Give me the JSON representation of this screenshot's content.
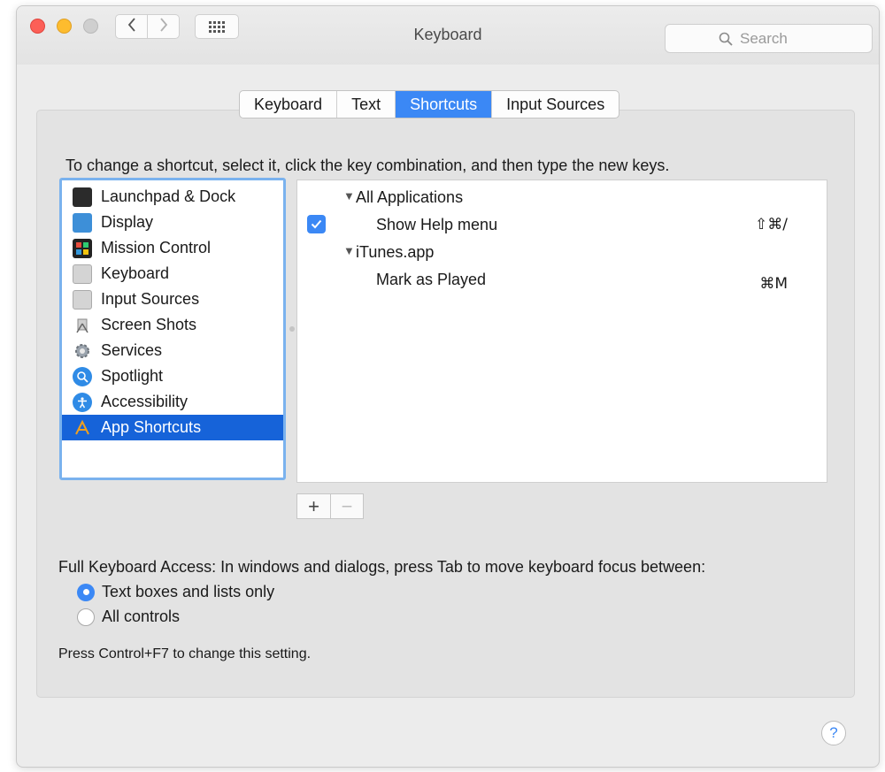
{
  "window": {
    "title": "Keyboard"
  },
  "search": {
    "placeholder": "Search"
  },
  "tabs": [
    {
      "label": "Keyboard",
      "active": false
    },
    {
      "label": "Text",
      "active": false
    },
    {
      "label": "Shortcuts",
      "active": true
    },
    {
      "label": "Input Sources",
      "active": false
    }
  ],
  "instruction": "To change a shortcut, select it, click the key combination, and then type the new keys.",
  "categories": [
    {
      "label": "Launchpad & Dock",
      "icon": "launchpad-dock-icon"
    },
    {
      "label": "Display",
      "icon": "display-icon"
    },
    {
      "label": "Mission Control",
      "icon": "mission-control-icon"
    },
    {
      "label": "Keyboard",
      "icon": "keyboard-icon"
    },
    {
      "label": "Input Sources",
      "icon": "input-sources-icon"
    },
    {
      "label": "Screen Shots",
      "icon": "screen-shots-icon"
    },
    {
      "label": "Services",
      "icon": "services-icon"
    },
    {
      "label": "Spotlight",
      "icon": "spotlight-icon"
    },
    {
      "label": "Accessibility",
      "icon": "accessibility-icon"
    },
    {
      "label": "App Shortcuts",
      "icon": "app-shortcuts-icon",
      "selected": true
    }
  ],
  "shortcuts": {
    "group1": {
      "label": "All Applications"
    },
    "item1": {
      "label": "Show Help menu",
      "keys": "⇧⌘/",
      "checked": true
    },
    "group2": {
      "label": "iTunes.app"
    },
    "item2": {
      "label": "Mark as Played",
      "keys": "⌘M"
    }
  },
  "buttons": {
    "add": "+",
    "remove": "−"
  },
  "full_keyboard_access": {
    "label": "Full Keyboard Access: In windows and dialogs, press Tab to move keyboard focus between:",
    "options": [
      {
        "label": "Text boxes and lists only",
        "selected": true
      },
      {
        "label": "All controls",
        "selected": false
      }
    ],
    "note": "Press Control+F7 to change this setting."
  },
  "help": {
    "label": "?"
  },
  "colors": {
    "accent": "#3b88f5",
    "selection": "#1663d9"
  }
}
